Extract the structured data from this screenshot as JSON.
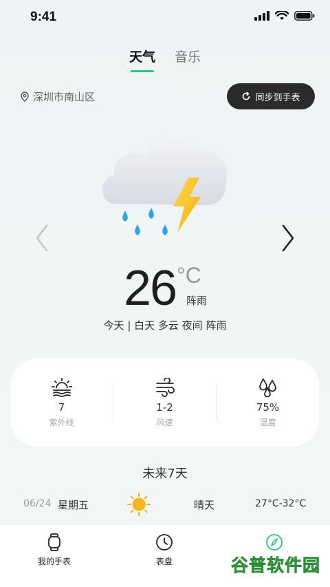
{
  "status_bar": {
    "time": "9:41"
  },
  "tabs": [
    {
      "label": "天气",
      "active": true
    },
    {
      "label": "音乐",
      "active": false
    }
  ],
  "location": {
    "text": "深圳市南山区",
    "icon": "location-pin-icon"
  },
  "sync_button": {
    "label": "同步到手表",
    "icon": "sync-icon"
  },
  "current": {
    "temperature": "26",
    "unit": "°C",
    "condition": "阵雨",
    "summary": "今天 | 白天 多云  夜间 阵雨",
    "icon": "thunder-rain-cloud-icon"
  },
  "metrics": [
    {
      "value": "7",
      "label": "紫外线",
      "icon": "uv-sun-icon"
    },
    {
      "value": "1-2",
      "label": "风速",
      "icon": "wind-icon"
    },
    {
      "value": "75%",
      "label": "湿度",
      "icon": "humidity-drops-icon"
    }
  ],
  "forecast": {
    "title": "未来7天",
    "days": [
      {
        "date": "06/24",
        "weekday": "星期五",
        "icon": "sunny-icon",
        "condition": "晴天",
        "range": "27°C-32°C"
      }
    ]
  },
  "bottom_nav": [
    {
      "label": "我的手表",
      "icon": "watch-icon"
    },
    {
      "label": "表盘",
      "icon": "clock-icon"
    },
    {
      "label": "",
      "icon": "compass-icon"
    }
  ],
  "watermark": {
    "text": "谷普软件园"
  },
  "colors": {
    "accent": "#2ec27e",
    "dark_button": "#2b2b2b",
    "sun": "#f6b51c",
    "rain": "#2aa6e8",
    "bolt": "#f8c21a"
  }
}
